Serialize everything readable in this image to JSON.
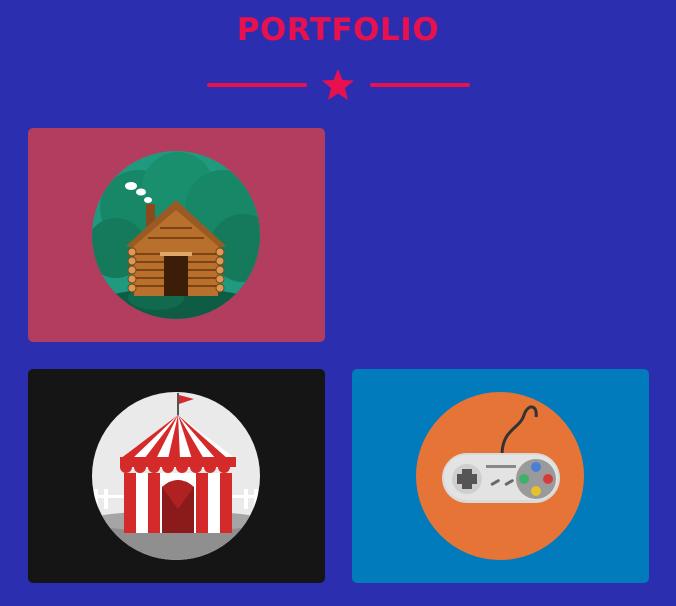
{
  "header": {
    "title": "PORTFOLIO",
    "divider_icon": "star-icon",
    "accent_color": "#e8104f",
    "background_color": "#2c2eb0"
  },
  "portfolio": {
    "items": [
      {
        "icon": "log-cabin-icon",
        "background": "#b33d5e"
      },
      {
        "icon": "circus-tent-icon",
        "background": "#151515"
      },
      {
        "icon": "game-controller-icon",
        "background": "#017bbc"
      }
    ]
  }
}
